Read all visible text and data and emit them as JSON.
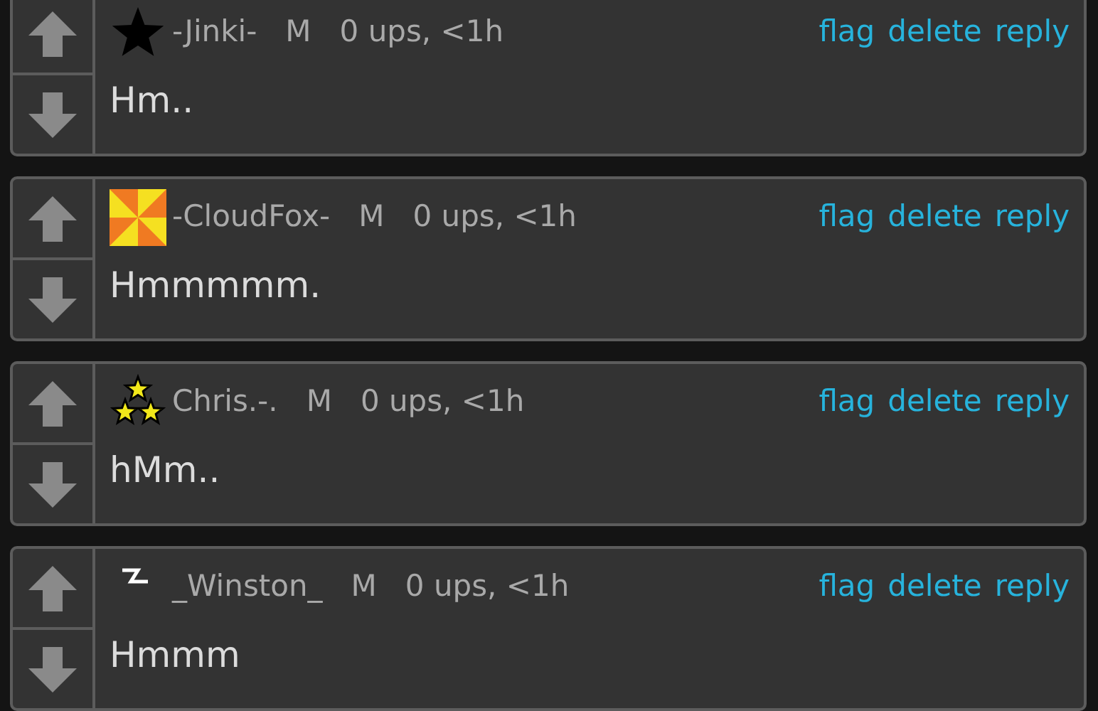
{
  "comments": [
    {
      "avatar": {
        "kind": "star"
      },
      "username": "-Jinki-",
      "flair": "M",
      "meta": "0 ups, <1h",
      "actions": [
        "flag",
        "delete",
        "reply"
      ],
      "text": "Hm.."
    },
    {
      "avatar": {
        "kind": "pinwheel"
      },
      "username": "-CloudFox-",
      "flair": "M",
      "meta": "0 ups, <1h",
      "actions": [
        "flag",
        "delete",
        "reply"
      ],
      "text": "Hmmmmm."
    },
    {
      "avatar": {
        "kind": "three-stars"
      },
      "username": "Chris.-.",
      "flair": "M",
      "meta": "0 ups, <1h",
      "actions": [
        "flag",
        "delete",
        "reply"
      ],
      "text": "hMm.."
    },
    {
      "avatar": {
        "kind": "squiggle"
      },
      "username": "_Winston_",
      "flair": "M",
      "meta": "0 ups, <1h",
      "actions": [
        "flag",
        "delete",
        "reply"
      ],
      "text": "Hmmm"
    }
  ]
}
